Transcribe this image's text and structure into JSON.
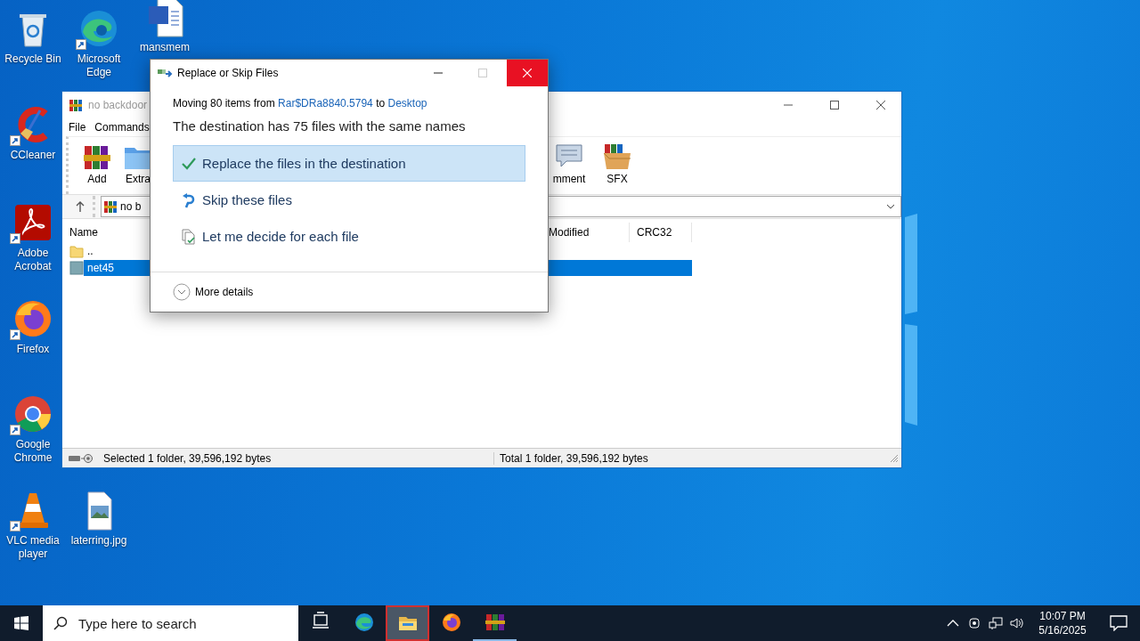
{
  "desktop_icons": [
    {
      "label": "Recycle Bin",
      "kind": "recycle-bin",
      "shortcut": false
    },
    {
      "label": "Microsoft Edge",
      "kind": "edge",
      "shortcut": true
    },
    {
      "label": "mansmem",
      "kind": "word",
      "shortcut": false
    },
    {
      "label": "CCleaner",
      "kind": "ccleaner",
      "shortcut": true
    },
    {
      "label": "Adobe Acrobat",
      "kind": "acrobat",
      "shortcut": true
    },
    {
      "label": "Firefox",
      "kind": "firefox",
      "shortcut": true
    },
    {
      "label": "Google Chrome",
      "kind": "chrome",
      "shortcut": true
    },
    {
      "label": "VLC media player",
      "kind": "vlc",
      "shortcut": true
    },
    {
      "label": "laterring.jpg",
      "kind": "image",
      "shortcut": false
    }
  ],
  "archiver_window": {
    "title": "no backdoor",
    "menu": [
      "File",
      "Commands"
    ],
    "toolbar": [
      {
        "label": "Add",
        "kind": "add"
      },
      {
        "label": "Extra",
        "kind": "extract"
      },
      {
        "label": "mment",
        "kind": "comment"
      },
      {
        "label": "SFX",
        "kind": "sfx"
      }
    ],
    "path": "no b",
    "columns": [
      "Name",
      "Modified",
      "CRC32"
    ],
    "rows": [
      {
        "name": "..",
        "kind": "up",
        "selected": false
      },
      {
        "name": "net45",
        "kind": "folder",
        "selected": true
      }
    ],
    "status_left": "Selected 1 folder, 39,596,192 bytes",
    "status_right": "Total 1 folder, 39,596,192 bytes"
  },
  "dialog": {
    "title": "Replace or Skip Files",
    "info": {
      "prefix": "Moving 80 items from",
      "source": "Rar$DRa8840.5794",
      "middle": "to",
      "destination": "Desktop"
    },
    "heading": "The destination has 75 files with the same names",
    "options": [
      {
        "label": "Replace the files in the destination",
        "kind": "replace",
        "selected": true
      },
      {
        "label": "Skip these files",
        "kind": "skip",
        "selected": false
      },
      {
        "label": "Let me decide for each file",
        "kind": "decide",
        "selected": false
      }
    ],
    "more": "More details"
  },
  "taskbar": {
    "search_placeholder": "Type here to search",
    "apps": [
      {
        "kind": "task-view",
        "running": false,
        "highlighted": false
      },
      {
        "kind": "edge",
        "running": false,
        "highlighted": false
      },
      {
        "kind": "explorer",
        "running": true,
        "highlighted": true
      },
      {
        "kind": "firefox",
        "running": false,
        "highlighted": false
      },
      {
        "kind": "winrar",
        "running": true,
        "highlighted": false
      }
    ],
    "time": "10:07 PM",
    "date": "5/16/2025"
  }
}
